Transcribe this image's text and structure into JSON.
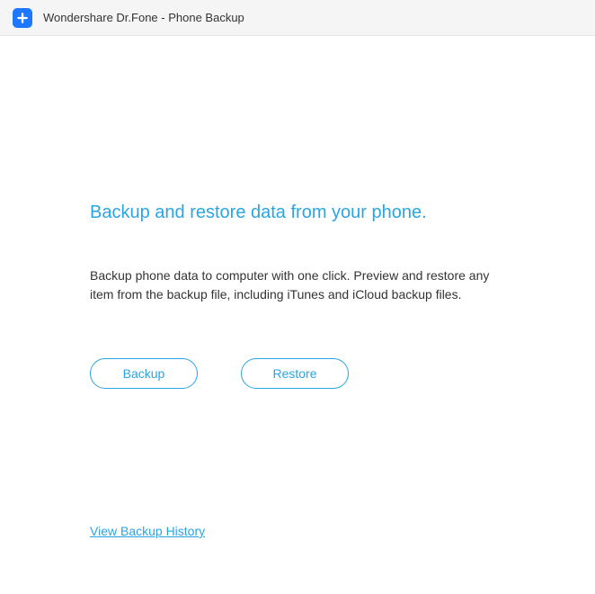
{
  "titleBar": {
    "appTitle": "Wondershare Dr.Fone - Phone Backup"
  },
  "main": {
    "headline": "Backup and restore data from your phone.",
    "description": "Backup phone data to computer with one click. Preview and restore any item from the backup file, including iTunes and iCloud backup files.",
    "buttons": {
      "backup": "Backup",
      "restore": "Restore"
    },
    "historyLink": "View Backup History"
  }
}
